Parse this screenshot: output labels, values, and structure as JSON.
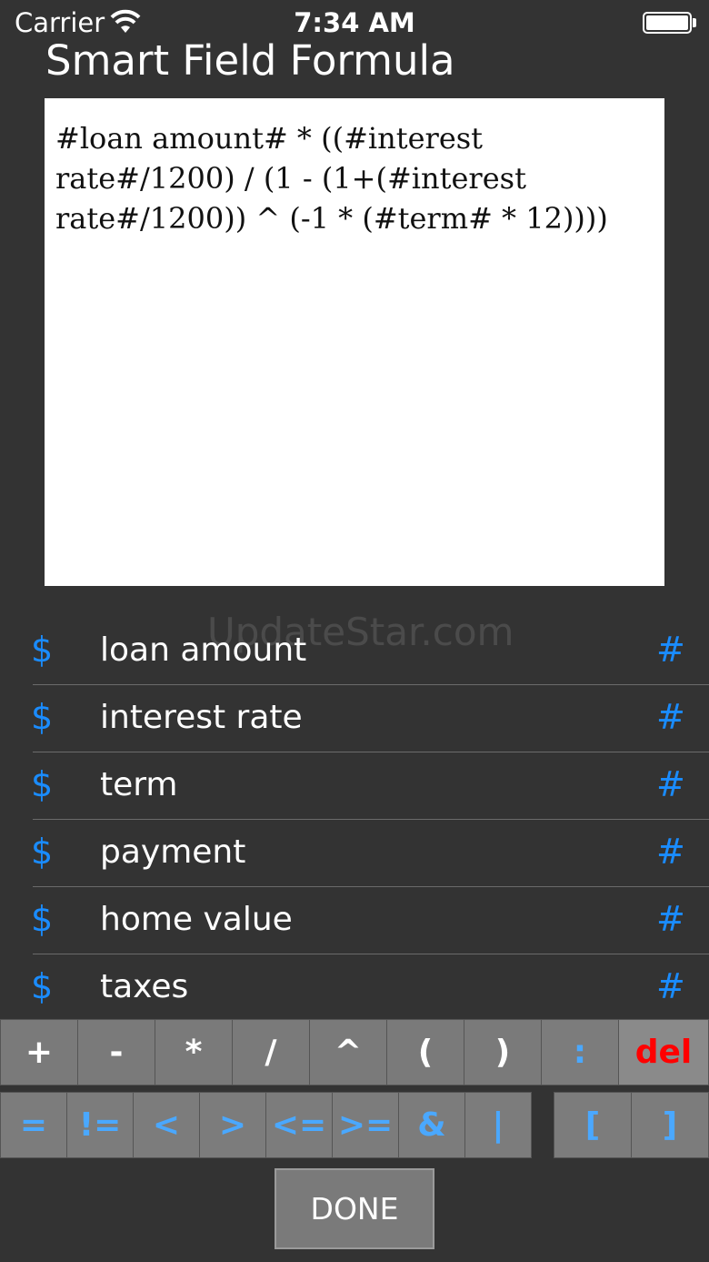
{
  "status_bar": {
    "carrier": "Carrier",
    "time": "7:34 AM"
  },
  "title": "Smart Field Formula",
  "formula": "#loan amount# * ((#interest rate#/1200) / (1 - (1+(#interest rate#/1200)) ^ (-1 * (#term# * 12))))",
  "watermark": "UpdateStar.com",
  "fields": [
    {
      "dollar": "$",
      "name": "loan amount",
      "hash": "#"
    },
    {
      "dollar": "$",
      "name": "interest rate",
      "hash": "#"
    },
    {
      "dollar": "$",
      "name": "term",
      "hash": "#"
    },
    {
      "dollar": "$",
      "name": "payment",
      "hash": "#"
    },
    {
      "dollar": "$",
      "name": "home value",
      "hash": "#"
    },
    {
      "dollar": "$",
      "name": "taxes",
      "hash": "#"
    }
  ],
  "keys_row1": [
    "+",
    "-",
    "*",
    "/",
    "^",
    "(",
    ")",
    ":",
    "del"
  ],
  "keys_row2": [
    "=",
    "!=",
    "<",
    ">",
    "<=",
    ">=",
    "&",
    "|",
    "[",
    "]"
  ],
  "done_label": "DONE",
  "colors": {
    "background": "#333333",
    "accent_blue": "#1a8cff",
    "operator_blue": "#4aa8ff",
    "delete_red": "#ff0000"
  }
}
